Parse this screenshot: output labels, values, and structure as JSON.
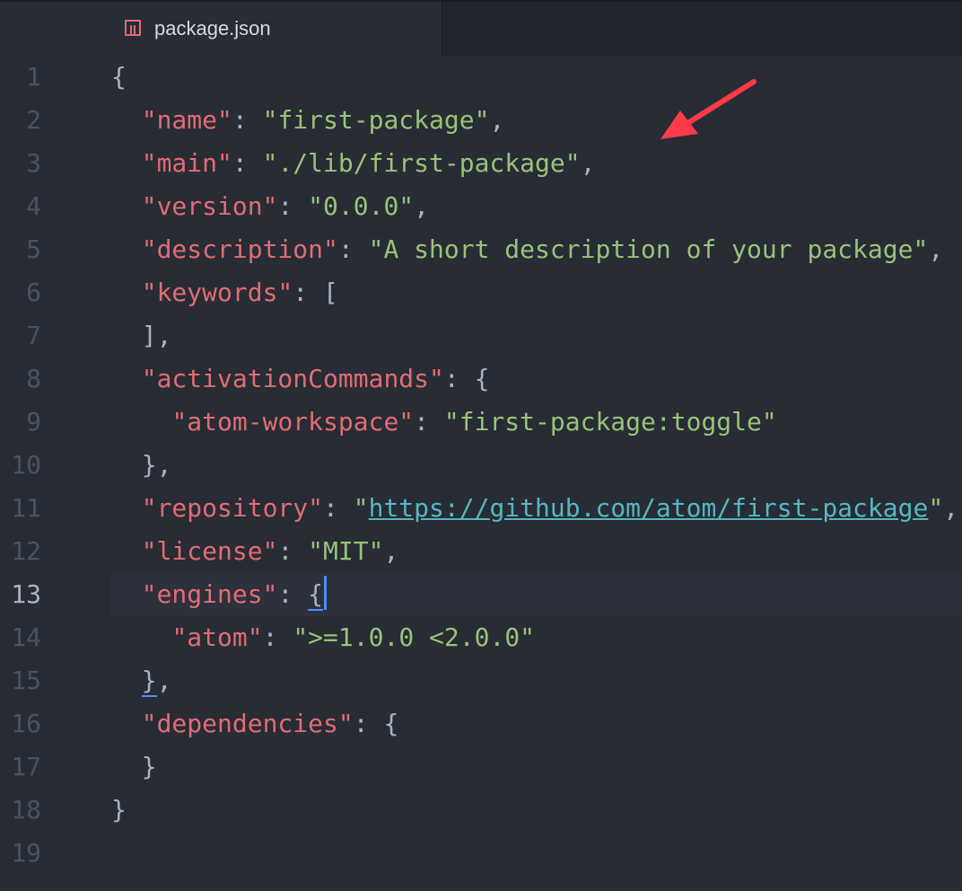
{
  "tab": {
    "title": "package.json",
    "icon": "file-package-icon"
  },
  "editor": {
    "lines": [
      {
        "num": "1",
        "indent": "",
        "tokens": [
          {
            "t": "punc",
            "v": "{"
          }
        ]
      },
      {
        "num": "2",
        "indent": "  ",
        "tokens": [
          {
            "t": "key",
            "v": "\"name\""
          },
          {
            "t": "punc",
            "v": ": "
          },
          {
            "t": "str",
            "v": "\"first-package\""
          },
          {
            "t": "punc",
            "v": ","
          }
        ]
      },
      {
        "num": "3",
        "indent": "  ",
        "tokens": [
          {
            "t": "key",
            "v": "\"main\""
          },
          {
            "t": "punc",
            "v": ": "
          },
          {
            "t": "str",
            "v": "\"./lib/first-package\""
          },
          {
            "t": "punc",
            "v": ","
          }
        ]
      },
      {
        "num": "4",
        "indent": "  ",
        "tokens": [
          {
            "t": "key",
            "v": "\"version\""
          },
          {
            "t": "punc",
            "v": ": "
          },
          {
            "t": "str",
            "v": "\"0.0.0\""
          },
          {
            "t": "punc",
            "v": ","
          }
        ]
      },
      {
        "num": "5",
        "indent": "  ",
        "tokens": [
          {
            "t": "key",
            "v": "\"description\""
          },
          {
            "t": "punc",
            "v": ": "
          },
          {
            "t": "str",
            "v": "\"A short description of your package\""
          },
          {
            "t": "punc",
            "v": ","
          }
        ]
      },
      {
        "num": "6",
        "indent": "  ",
        "tokens": [
          {
            "t": "key",
            "v": "\"keywords\""
          },
          {
            "t": "punc",
            "v": ": ["
          }
        ]
      },
      {
        "num": "7",
        "indent": "  ",
        "tokens": [
          {
            "t": "punc",
            "v": "],"
          }
        ]
      },
      {
        "num": "8",
        "indent": "  ",
        "tokens": [
          {
            "t": "key",
            "v": "\"activationCommands\""
          },
          {
            "t": "punc",
            "v": ": {"
          }
        ]
      },
      {
        "num": "9",
        "indent": "    ",
        "tokens": [
          {
            "t": "key",
            "v": "\"atom-workspace\""
          },
          {
            "t": "punc",
            "v": ": "
          },
          {
            "t": "str",
            "v": "\"first-package:toggle\""
          }
        ]
      },
      {
        "num": "10",
        "indent": "  ",
        "tokens": [
          {
            "t": "punc",
            "v": "},"
          }
        ]
      },
      {
        "num": "11",
        "indent": "  ",
        "tokens": [
          {
            "t": "key",
            "v": "\"repository\""
          },
          {
            "t": "punc",
            "v": ": "
          },
          {
            "t": "str",
            "v": "\""
          },
          {
            "t": "url",
            "v": "https://github.com/atom/first-package"
          },
          {
            "t": "str",
            "v": "\""
          },
          {
            "t": "punc",
            "v": ","
          }
        ]
      },
      {
        "num": "12",
        "indent": "  ",
        "tokens": [
          {
            "t": "key",
            "v": "\"license\""
          },
          {
            "t": "punc",
            "v": ": "
          },
          {
            "t": "str",
            "v": "\"MIT\""
          },
          {
            "t": "punc",
            "v": ","
          }
        ]
      },
      {
        "num": "13",
        "indent": "  ",
        "cursor": true,
        "tokens": [
          {
            "t": "key",
            "v": "\"engines\""
          },
          {
            "t": "punc",
            "v": ": "
          },
          {
            "t": "punc",
            "v": "{",
            "match": true
          },
          {
            "t": "cursor",
            "v": ""
          }
        ]
      },
      {
        "num": "14",
        "indent": "    ",
        "tokens": [
          {
            "t": "key",
            "v": "\"atom\""
          },
          {
            "t": "punc",
            "v": ": "
          },
          {
            "t": "str",
            "v": "\">=1.0.0 <2.0.0\""
          }
        ]
      },
      {
        "num": "15",
        "indent": "  ",
        "tokens": [
          {
            "t": "punc",
            "v": "}",
            "match": true
          },
          {
            "t": "punc",
            "v": ","
          }
        ]
      },
      {
        "num": "16",
        "indent": "  ",
        "tokens": [
          {
            "t": "key",
            "v": "\"dependencies\""
          },
          {
            "t": "punc",
            "v": ": {"
          }
        ]
      },
      {
        "num": "17",
        "indent": "  ",
        "tokens": [
          {
            "t": "punc",
            "v": "}"
          }
        ]
      },
      {
        "num": "18",
        "indent": "",
        "tokens": [
          {
            "t": "punc",
            "v": "}"
          }
        ]
      },
      {
        "num": "19",
        "indent": "",
        "tokens": []
      }
    ]
  },
  "annotation": {
    "icon": "red-arrow-icon",
    "color": "#ff3b47"
  },
  "colors": {
    "background": "#282c34",
    "key": "#e06c75",
    "string": "#98c379",
    "url": "#56b6c2",
    "punctuation": "#abb2bf",
    "gutter": "#4b5263",
    "cursor": "#528bff"
  }
}
